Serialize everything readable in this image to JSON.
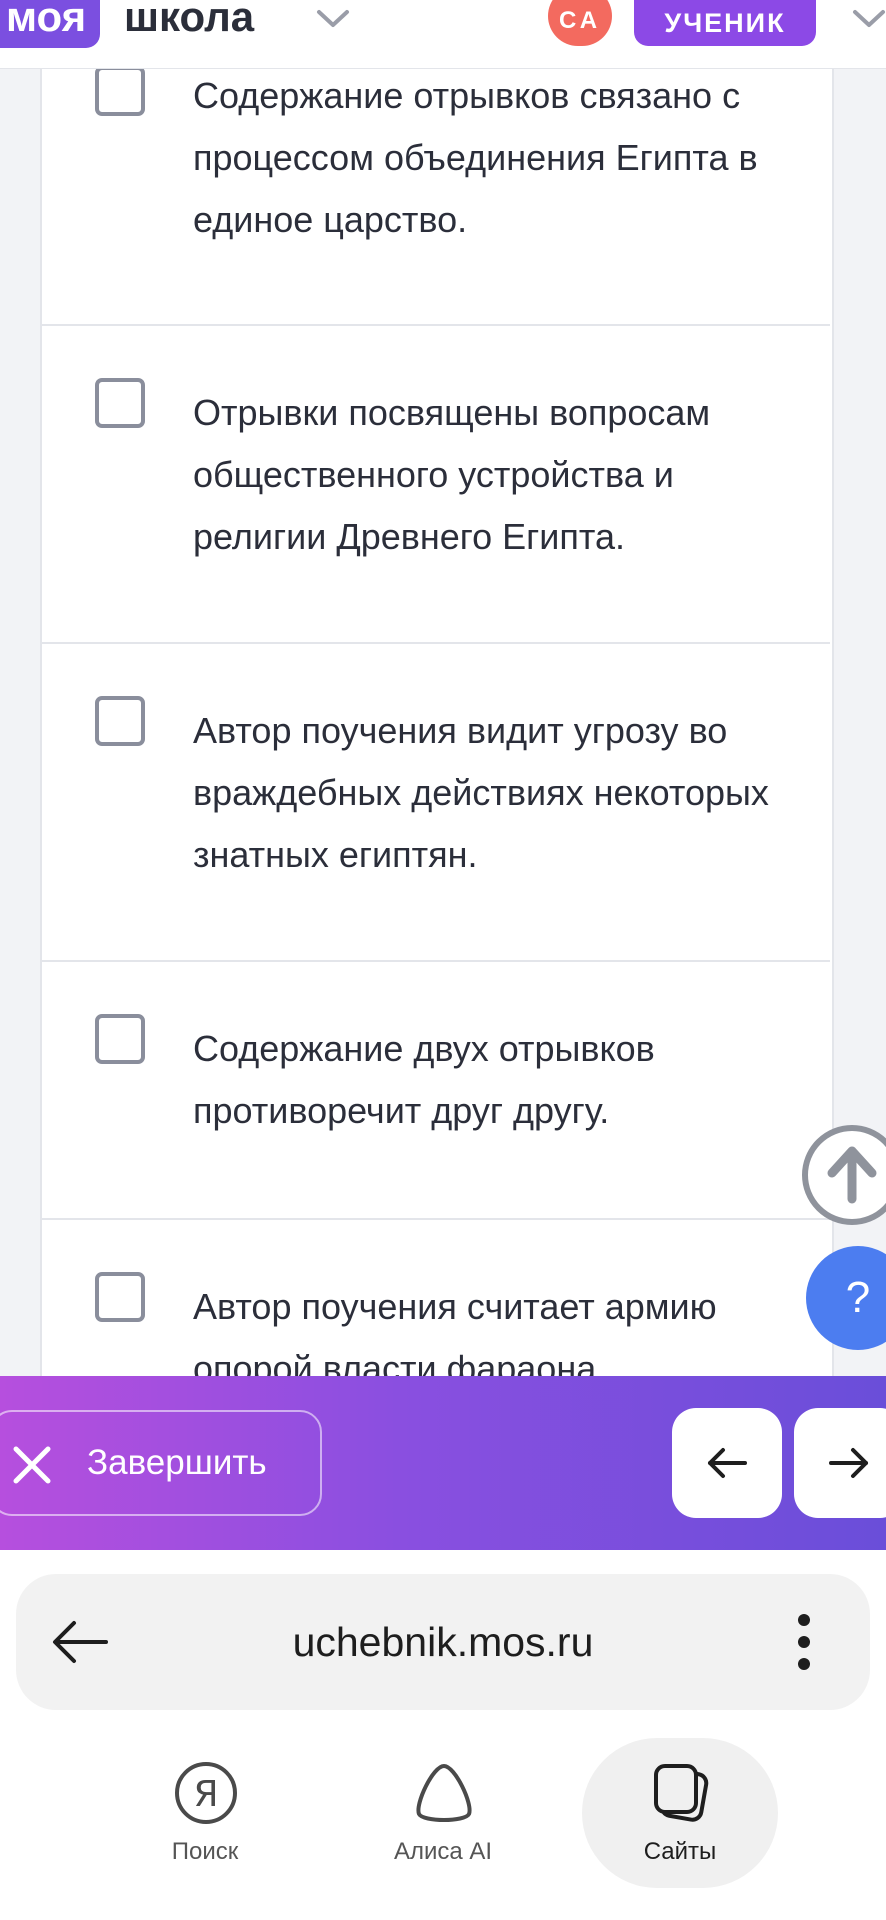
{
  "header": {
    "logo_part1": "моя",
    "logo_part2": "школа",
    "avatar_initials": "СА",
    "role": "УЧЕНИК"
  },
  "options": [
    {
      "text": "Содержание отрывков связано с процессом объединения Египта в единое царство.",
      "checked": false
    },
    {
      "text": "Отрывки посвящены вопросам общественного устройства и религии Древнего Египта.",
      "checked": false
    },
    {
      "text": "Автор поучения видит угрозу во враждебных действиях некоторых знатных египтян.",
      "checked": false
    },
    {
      "text": "Содержание двух отрывков противоречит друг другу.",
      "checked": false
    },
    {
      "text": "Автор поучения считает армию опорой власти фараона.",
      "checked": false
    }
  ],
  "fab": {
    "help_label": "?"
  },
  "actionbar": {
    "finish_label": "Завершить"
  },
  "browser": {
    "url": "uchebnik.mos.ru",
    "tabs": [
      {
        "label": "Поиск",
        "icon": "yandex-search-icon",
        "active": false
      },
      {
        "label": "Алиса AI",
        "icon": "alice-icon",
        "active": false
      },
      {
        "label": "Сайты",
        "icon": "sites-icon",
        "active": true
      }
    ]
  },
  "colors": {
    "brand_purple": "#7b4fe0",
    "avatar": "#f36a5f",
    "help_button": "#4c7df0"
  }
}
